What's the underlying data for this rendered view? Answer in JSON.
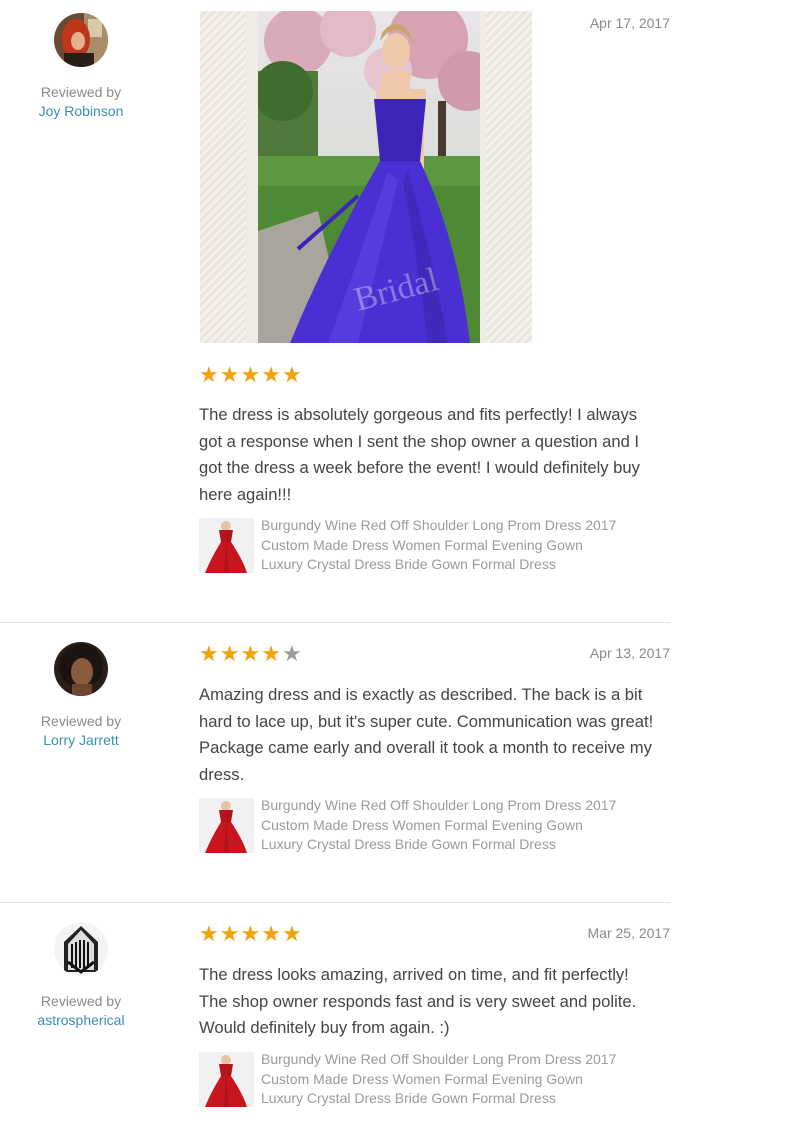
{
  "reviews": [
    {
      "reviewed_by_label": "Reviewed by",
      "reviewer": "Joy Robinson",
      "date": "Apr 17, 2017",
      "rating": 5,
      "rating_display": "5 of 5 stars",
      "has_photo": true,
      "photo_watermark": "Bridal",
      "text": "The dress is absolutely gorgeous and fits perfectly! I always got a response when I sent the shop owner a question and I got the dress a week before the event! I would definitely buy here again!!!",
      "product_title": "Burgundy Wine Red Off Shoulder Long Prom Dress 2017 Custom Made Dress Women Formal Evening Gown Luxury Crystal Dress Bride Gown Formal Dress"
    },
    {
      "reviewed_by_label": "Reviewed by",
      "reviewer": "Lorry Jarrett",
      "date": "Apr 13, 2017",
      "rating": 4,
      "rating_display": "4 of 5 stars",
      "has_photo": false,
      "text": "Amazing dress and is exactly as described. The back is a bit hard to lace up, but it's super cute. Communication was great! Package came early and overall it took a month to receive my dress.",
      "product_title": "Burgundy Wine Red Off Shoulder Long Prom Dress 2017 Custom Made Dress Women Formal Evening Gown Luxury Crystal Dress Bride Gown Formal Dress"
    },
    {
      "reviewed_by_label": "Reviewed by",
      "reviewer": "astrospherical",
      "date": "Mar 25, 2017",
      "rating": 5,
      "rating_display": "5 of 5 stars",
      "has_photo": false,
      "text": "The dress looks amazing, arrived on time, and fit perfectly! The shop owner responds fast and is very sweet and polite. Would definitely buy from again. :)",
      "product_title": "Burgundy Wine Red Off Shoulder Long Prom Dress 2017 Custom Made Dress Women Formal Evening Gown Luxury Crystal Dress Bride Gown Formal Dress"
    }
  ],
  "colors": {
    "star_filled": "#f1a10c",
    "star_empty": "#9c9c9c",
    "reviewer_link": "#3a8fb0",
    "muted_text": "#8a8a8a",
    "body_text": "#444444"
  },
  "icons": {
    "star_filled": "star-filled-icon",
    "star_empty": "star-empty-icon"
  }
}
